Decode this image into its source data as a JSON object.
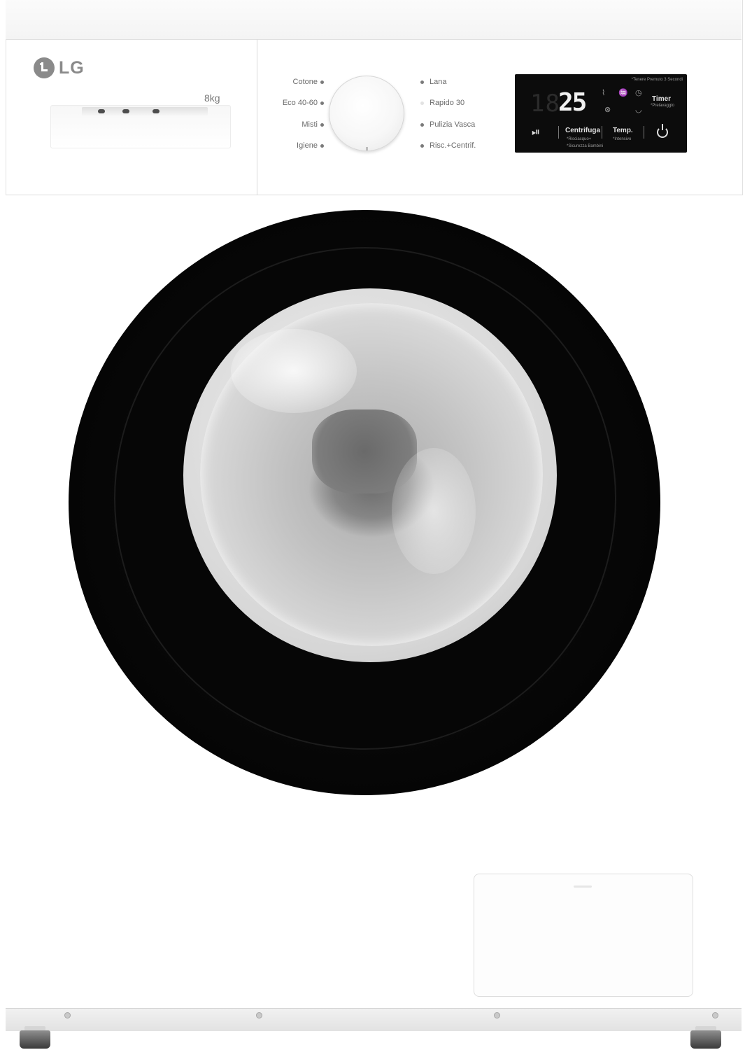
{
  "brand": {
    "name": "LG"
  },
  "capacity": "8kg",
  "programs": {
    "left": [
      "Cotone",
      "Eco 40-60",
      "Misti",
      "Igiene"
    ],
    "right": [
      "Lana",
      "Rapido 30",
      "Pulizia Vasca",
      "Risc.+Centrif."
    ]
  },
  "display": {
    "note": "*Tenere Premuto 3 Secondi",
    "digits_dim": "18",
    "time_value": "25",
    "timer_label": "Timer",
    "timer_sub": "*Prelavaggio",
    "spin_label": "Centrifuga",
    "spin_sub": "*Risciacquo+",
    "temp_label": "Temp.",
    "temp_sub": "*Intensivo",
    "child_lock": "*Sicurezza Bambini",
    "play_icon": "play-pause-icon",
    "power_icon": "power-icon"
  },
  "colors": {
    "body": "#ffffff",
    "door": "#050505",
    "display": "#0c0c0c"
  }
}
